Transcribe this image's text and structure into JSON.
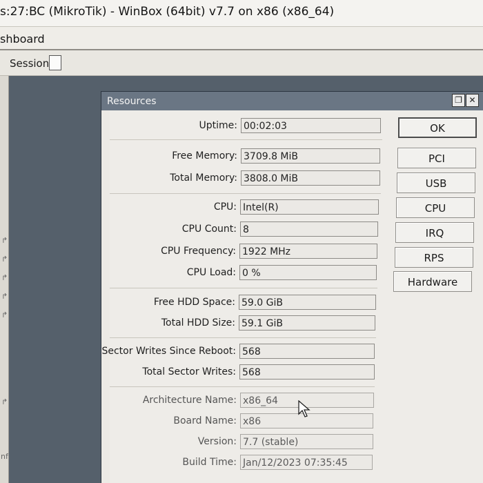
{
  "window": {
    "title": "s:27:BC (MikroTik) - WinBox (64bit) v7.7 on x86 (x86_64)",
    "menu_label": "shboard",
    "session_label": "Session:",
    "side_label": "nf"
  },
  "dialog": {
    "title": "Resources",
    "maximize_icon": "restore-icon",
    "close_icon": "close-icon",
    "fields": {
      "uptime": {
        "label": "Uptime:",
        "value": "00:02:03"
      },
      "free_memory": {
        "label": "Free Memory:",
        "value": "3709.8 MiB"
      },
      "total_memory": {
        "label": "Total Memory:",
        "value": "3808.0 MiB"
      },
      "cpu": {
        "label": "CPU:",
        "value": "Intel(R)"
      },
      "cpu_count": {
        "label": "CPU Count:",
        "value": "8"
      },
      "cpu_frequency": {
        "label": "CPU Frequency:",
        "value": "1922 MHz"
      },
      "cpu_load": {
        "label": "CPU Load:",
        "value": "0 %"
      },
      "free_hdd": {
        "label": "Free HDD Space:",
        "value": "59.0 GiB"
      },
      "total_hdd": {
        "label": "Total HDD Size:",
        "value": "59.1 GiB"
      },
      "sector_writes_reboot": {
        "label": "Sector Writes Since Reboot:",
        "value": "568"
      },
      "total_sector_writes": {
        "label": "Total Sector Writes:",
        "value": "568"
      },
      "architecture": {
        "label": "Architecture Name:",
        "value": "x86_64"
      },
      "board_name": {
        "label": "Board Name:",
        "value": "x86"
      },
      "version": {
        "label": "Version:",
        "value": "7.7 (stable)"
      },
      "build_time": {
        "label": "Build Time:",
        "value": "Jan/12/2023 07:35:45"
      }
    },
    "buttons": {
      "ok": "OK",
      "pci": "PCI",
      "usb": "USB",
      "cpu": "CPU",
      "irq": "IRQ",
      "rps": "RPS",
      "hardware": "Hardware"
    }
  },
  "colors": {
    "dialog_titlebar": "#6a7684",
    "workspace": "#55606b"
  }
}
